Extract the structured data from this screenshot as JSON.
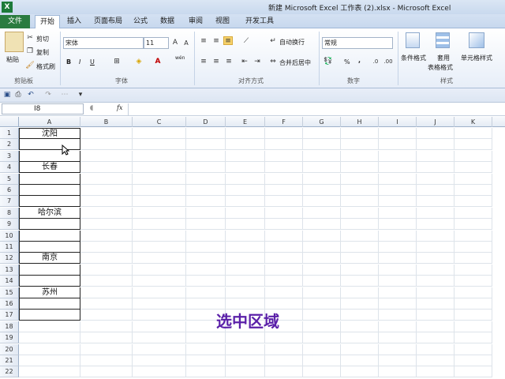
{
  "window": {
    "title": "新建 Microsoft Excel 工作表 (2).xlsx - Microsoft Excel",
    "app_icon": "X"
  },
  "tabs": [
    {
      "id": "file",
      "label": "文件"
    },
    {
      "id": "home",
      "label": "开始"
    },
    {
      "id": "insert",
      "label": "插入"
    },
    {
      "id": "layout",
      "label": "页面布局"
    },
    {
      "id": "formula",
      "label": "公式"
    },
    {
      "id": "data",
      "label": "数据"
    },
    {
      "id": "review",
      "label": "审阅"
    },
    {
      "id": "view",
      "label": "视图"
    },
    {
      "id": "dev",
      "label": "开发工具"
    }
  ],
  "ribbon": {
    "clipboard": {
      "paste": "粘贴",
      "cut": "剪切",
      "copy": "复制",
      "format_painter": "格式刷",
      "group": "剪贴板"
    },
    "font": {
      "name": "宋体",
      "size": "11",
      "bold": "B",
      "italic": "I",
      "underline": "U",
      "group": "字体",
      "wen": "wén"
    },
    "align": {
      "wrap": "自动换行",
      "merge": "合并后居中",
      "group": "对齐方式"
    },
    "number": {
      "format": "常规",
      "percent": "%",
      "comma": ",",
      "group": "数字"
    },
    "styles": {
      "conditional": "条件格式",
      "table_fmt_1": "套用",
      "table_fmt_2": "表格格式",
      "cell_styles": "单元格样式",
      "group": "样式"
    }
  },
  "formula_bar": {
    "name_box": "I8",
    "fx": "fx"
  },
  "columns": [
    "A",
    "B",
    "C",
    "D",
    "E",
    "F",
    "G",
    "H",
    "I",
    "J",
    "K"
  ],
  "rows": [
    "1",
    "2",
    "3",
    "4",
    "5",
    "6",
    "7",
    "8",
    "9",
    "10",
    "11",
    "12",
    "13",
    "14",
    "15",
    "16",
    "17",
    "18",
    "19",
    "20",
    "21",
    "22"
  ],
  "cells_a": [
    "沈阳",
    "",
    "",
    "长春",
    "",
    "",
    "",
    "哈尔滨",
    "",
    "",
    "",
    "南京",
    "",
    "",
    "苏州",
    "",
    ""
  ],
  "caption": "选中区域",
  "colors": {
    "accent": "#5a1fa8",
    "file_tab": "#2a7b3f"
  }
}
